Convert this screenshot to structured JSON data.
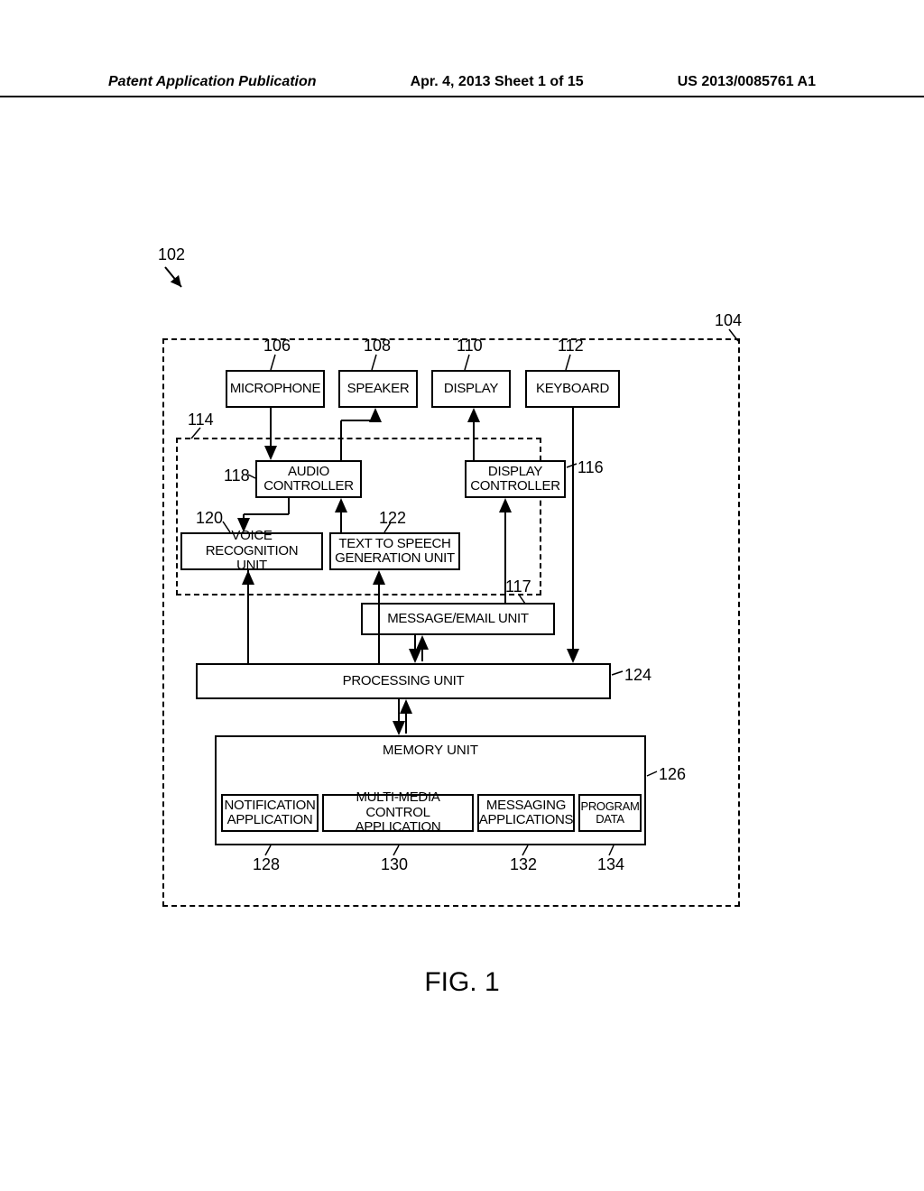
{
  "header": {
    "left": "Patent Application Publication",
    "center": "Apr. 4, 2013  Sheet 1 of 15",
    "right": "US 2013/0085761 A1"
  },
  "refs": {
    "r102": "102",
    "r104": "104",
    "r106": "106",
    "r108": "108",
    "r110": "110",
    "r112": "112",
    "r114": "114",
    "r116": "116",
    "r117": "117",
    "r118": "118",
    "r120": "120",
    "r122": "122",
    "r124": "124",
    "r126": "126",
    "r128": "128",
    "r130": "130",
    "r132": "132",
    "r134": "134"
  },
  "boxes": {
    "microphone": "MICROPHONE",
    "speaker": "SPEAKER",
    "display": "DISPLAY",
    "keyboard": "KEYBOARD",
    "audio_ctl_l1": "AUDIO",
    "audio_ctl_l2": "CONTROLLER",
    "disp_ctl_l1": "DISPLAY",
    "disp_ctl_l2": "CONTROLLER",
    "voice_l1": "VOICE RECOGNITION",
    "voice_l2": "UNIT",
    "tts_l1": "TEXT TO SPEECH",
    "tts_l2": "GENERATION UNIT",
    "msgemail": "MESSAGE/EMAIL UNIT",
    "processing": "PROCESSING UNIT",
    "memory": "MEMORY UNIT",
    "notif_l1": "NOTIFICATION",
    "notif_l2": "APPLICATION",
    "mmca_l1": "MULTI-MEDIA",
    "mmca_l2": "CONTROL APPLICATION",
    "msgapp_l1": "MESSAGING",
    "msgapp_l2": "APPLICATIONS",
    "prog_l1": "PROGRAM",
    "prog_l2": "DATA"
  },
  "figure": "FIG. 1"
}
